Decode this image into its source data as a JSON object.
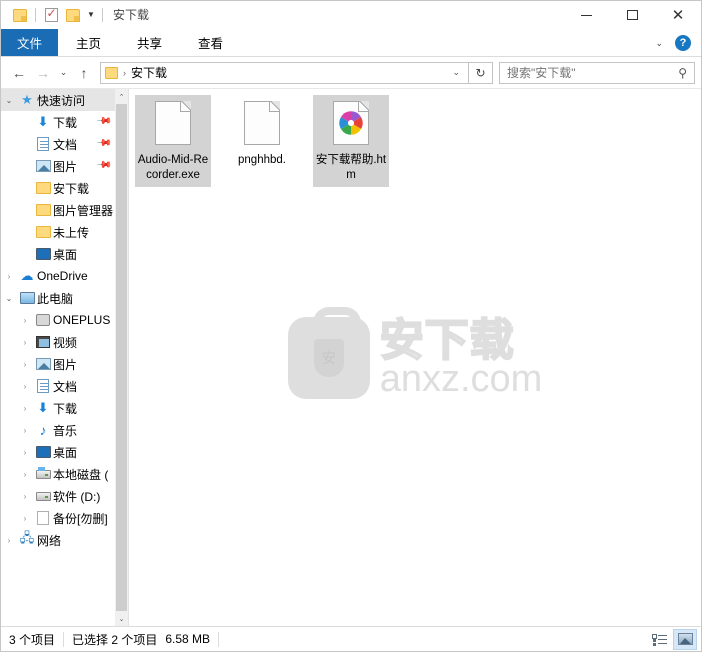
{
  "window": {
    "title": "安下载",
    "quick_access_toolbar": [
      {
        "name": "folder-icon",
        "label": "属性"
      },
      {
        "name": "properties-icon",
        "label": "属性"
      },
      {
        "name": "new-folder-icon",
        "label": "新建文件夹"
      }
    ],
    "controls": {
      "minimize": "—",
      "maximize": "□",
      "close": "✕"
    }
  },
  "ribbon": {
    "tabs": [
      {
        "label": "文件",
        "active": true
      },
      {
        "label": "主页",
        "active": false
      },
      {
        "label": "共享",
        "active": false
      },
      {
        "label": "查看",
        "active": false
      }
    ],
    "expand_caret": "⌄",
    "help_label": "?"
  },
  "address": {
    "back": "←",
    "forward": "→",
    "recent": "⌄",
    "up": "↑",
    "breadcrumb": "安下载",
    "path_separator": "›",
    "dropdown_caret": "⌄",
    "refresh": "↻"
  },
  "search": {
    "placeholder": "搜索\"安下载\"",
    "value": "",
    "icon": "search-icon"
  },
  "sidebar": {
    "items": [
      {
        "label": "快速访问",
        "icon": "pin-star-icon",
        "indent": 1,
        "arrow": "open",
        "selected": true,
        "pinned": false
      },
      {
        "label": "下载",
        "icon": "downloads-icon",
        "indent": 2,
        "arrow": "none",
        "selected": false,
        "pinned": true
      },
      {
        "label": "文档",
        "icon": "documents-icon",
        "indent": 2,
        "arrow": "none",
        "selected": false,
        "pinned": true
      },
      {
        "label": "图片",
        "icon": "pictures-icon",
        "indent": 2,
        "arrow": "none",
        "selected": false,
        "pinned": true
      },
      {
        "label": "安下载",
        "icon": "folder-icon",
        "indent": 2,
        "arrow": "none",
        "selected": false,
        "pinned": false
      },
      {
        "label": "图片管理器",
        "icon": "folder-icon",
        "indent": 2,
        "arrow": "none",
        "selected": false,
        "pinned": false
      },
      {
        "label": "未上传",
        "icon": "folder-icon",
        "indent": 2,
        "arrow": "none",
        "selected": false,
        "pinned": false
      },
      {
        "label": "桌面",
        "icon": "desktop-icon",
        "indent": 2,
        "arrow": "none",
        "selected": false,
        "pinned": false
      },
      {
        "label": "OneDrive",
        "icon": "onedrive-icon",
        "indent": 1,
        "arrow": "closed",
        "selected": false,
        "pinned": false
      },
      {
        "label": "此电脑",
        "icon": "this-pc-icon",
        "indent": 1,
        "arrow": "open",
        "selected": false,
        "pinned": false
      },
      {
        "label": "ONEPLUS",
        "icon": "phone-icon",
        "indent": 2,
        "arrow": "closed",
        "selected": false,
        "pinned": false
      },
      {
        "label": "视频",
        "icon": "videos-icon",
        "indent": 2,
        "arrow": "closed",
        "selected": false,
        "pinned": false
      },
      {
        "label": "图片",
        "icon": "pictures-icon",
        "indent": 2,
        "arrow": "closed",
        "selected": false,
        "pinned": false
      },
      {
        "label": "文档",
        "icon": "documents-icon",
        "indent": 2,
        "arrow": "closed",
        "selected": false,
        "pinned": false
      },
      {
        "label": "下载",
        "icon": "downloads-icon",
        "indent": 2,
        "arrow": "closed",
        "selected": false,
        "pinned": false
      },
      {
        "label": "音乐",
        "icon": "music-icon",
        "indent": 2,
        "arrow": "closed",
        "selected": false,
        "pinned": false
      },
      {
        "label": "桌面",
        "icon": "desktop-icon",
        "indent": 2,
        "arrow": "closed",
        "selected": false,
        "pinned": false
      },
      {
        "label": "本地磁盘 (",
        "icon": "system-drive-icon",
        "indent": 2,
        "arrow": "closed",
        "selected": false,
        "pinned": false
      },
      {
        "label": "软件 (D:)",
        "icon": "drive-icon",
        "indent": 2,
        "arrow": "closed",
        "selected": false,
        "pinned": false
      },
      {
        "label": "备份[勿删]",
        "icon": "blank-drive-icon",
        "indent": 2,
        "arrow": "closed",
        "selected": false,
        "pinned": false
      },
      {
        "label": "网络",
        "icon": "network-icon",
        "indent": 1,
        "arrow": "closed",
        "selected": false,
        "pinned": false
      }
    ],
    "scrollbar": {
      "up": "⌃",
      "down": "⌄"
    }
  },
  "files": [
    {
      "name": "Audio-Mid-Recorder.exe",
      "icon": "generic-file-icon",
      "selected": true
    },
    {
      "name": "pnghhbd.",
      "icon": "generic-file-icon",
      "selected": false
    },
    {
      "name": "安下载帮助.htm",
      "icon": "html-pinwheel-icon",
      "selected": true
    }
  ],
  "watermark": {
    "shield_char": "安",
    "cn_text": "安下载",
    "en_text": "anxz.com"
  },
  "statusbar": {
    "item_count": "3 个项目",
    "selection": "已选择 2 个项目",
    "size": "6.58 MB",
    "views": [
      {
        "name": "details-view-button",
        "active": false
      },
      {
        "name": "large-icons-view-button",
        "active": true
      }
    ]
  },
  "colors": {
    "accent": "#1a6cb5",
    "selection": "#d3d3d3",
    "sidebar_selection": "#e5e5e5",
    "folder": "#ffd97d",
    "watermark": "#dedede"
  }
}
